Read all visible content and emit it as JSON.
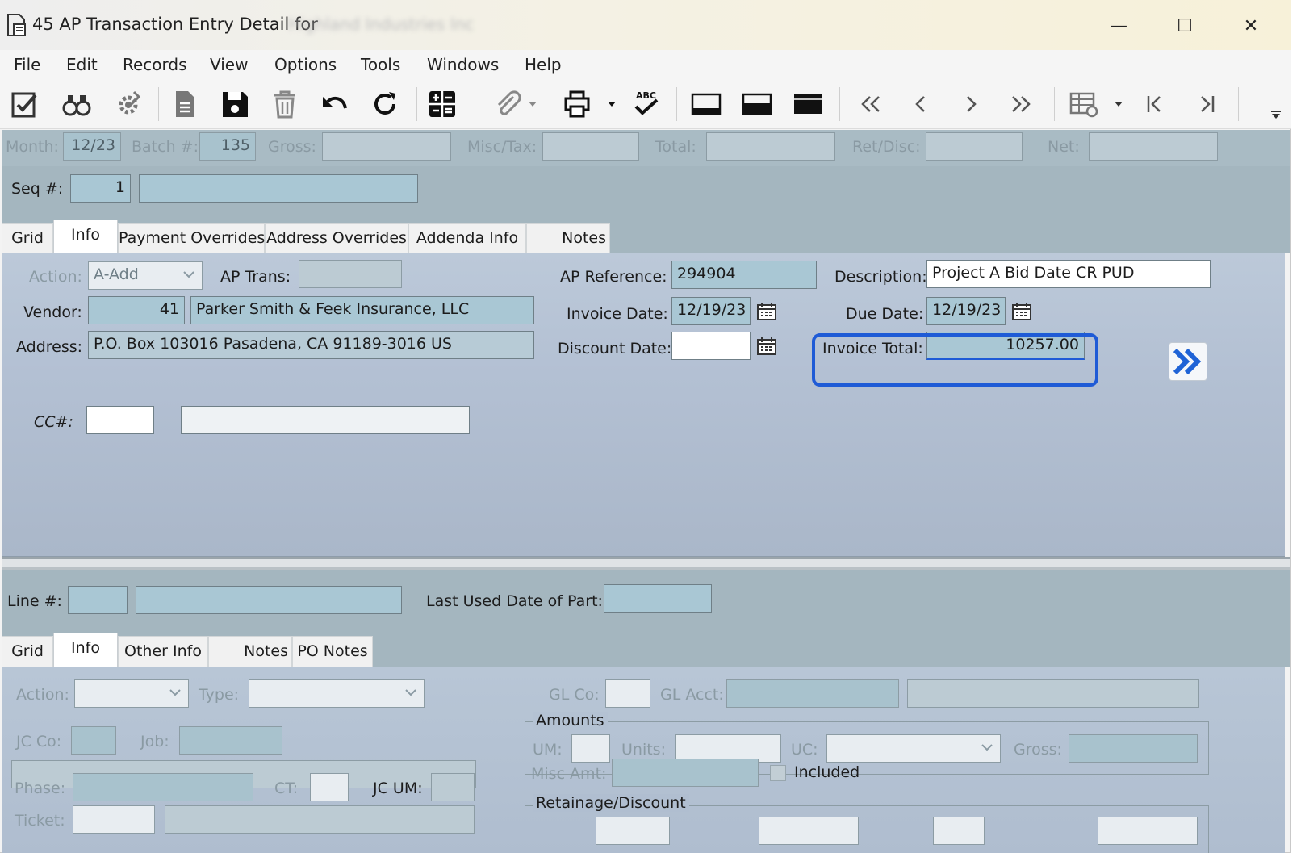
{
  "window": {
    "title": "45 AP Transaction Entry Detail for",
    "blurred_company": "Highland Industries Inc",
    "minimize": "—",
    "maximize": "☐",
    "close": "✕"
  },
  "menu": [
    "File",
    "Edit",
    "Records",
    "View",
    "Options",
    "Tools",
    "Windows",
    "Help"
  ],
  "header": {
    "month_label": "Month:",
    "month_value": "12/23",
    "batch_label": "Batch #:",
    "batch_value": "135",
    "gross_label": "Gross:",
    "misc_tax_label": "Misc/Tax:",
    "total_label": "Total:",
    "ret_disc_label": "Ret/Disc:",
    "net_label": "Net:"
  },
  "seq": {
    "label": "Seq #:",
    "value": "1"
  },
  "tabs_top": [
    "Grid",
    "Info",
    "Payment Overrides",
    "Address Overrides",
    "Addenda Info",
    "Notes"
  ],
  "info": {
    "action_label": "Action:",
    "action_value": "A-Add",
    "ap_trans_label": "AP Trans:",
    "ap_reference_label": "AP Reference:",
    "ap_reference_value": "294904",
    "description_label": "Description:",
    "description_value": "Project A Bid Date CR PUD",
    "vendor_label": "Vendor:",
    "vendor_id": "41",
    "vendor_name": "Parker Smith & Feek Insurance, LLC",
    "invoice_date_label": "Invoice Date:",
    "invoice_date_value": "12/19/23",
    "due_date_label": "Due Date:",
    "due_date_value": "12/19/23",
    "address_label": "Address:",
    "address_value": "P.O. Box 103016  Pasadena, CA  91189-3016  US",
    "discount_date_label": "Discount Date:",
    "invoice_total_label": "Invoice Total:",
    "invoice_total_value": "10257.00",
    "cc_label": "CC#:"
  },
  "line": {
    "line_label": "Line #:",
    "last_used_label": "Last Used Date of Part:"
  },
  "tabs_bottom": [
    "Grid",
    "Info",
    "Other Info",
    "Notes",
    "PO Notes"
  ],
  "line_info": {
    "action_label": "Action:",
    "type_label": "Type:",
    "gl_co_label": "GL Co:",
    "gl_acct_label": "GL Acct:",
    "amounts_label": "Amounts",
    "jc_co_label": "JC Co:",
    "job_label": "Job:",
    "um_label": "UM:",
    "units_label": "Units:",
    "uc_label": "UC:",
    "gross_label": "Gross:",
    "phase_label": "Phase:",
    "ct_label": "CT:",
    "jc_um_label": "JC UM:",
    "misc_amt_label": "Misc Amt:",
    "included_label": "Included",
    "retainage_label": "Retainage/Discount",
    "ticket_label": "Ticket:"
  },
  "colors": {
    "accent_focus": "#1f5bd6",
    "field_blue": "#a9c7d4",
    "panel": "#b3c0d3",
    "band": "#a4b6bf"
  }
}
